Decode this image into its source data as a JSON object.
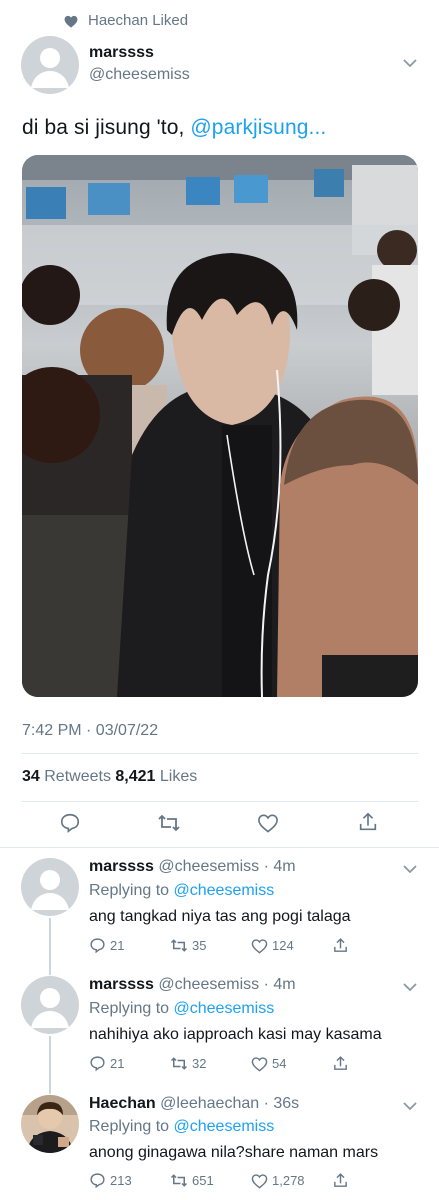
{
  "social_context": "Haechan Liked",
  "main_tweet": {
    "name": "marssss",
    "handle": "@cheesemiss",
    "text_prefix": "di ba si jisung 'to, ",
    "text_mention": "@parkjisung...",
    "timestamp": "7:42 PM · 03/07/22",
    "retweets_count": "34",
    "retweets_label": " Retweets  ",
    "likes_count": "8,421",
    "likes_label": " Likes"
  },
  "replies": [
    {
      "name": "marssss",
      "handle_time": " @cheesemiss · 4m",
      "replying_prefix": "Replying to ",
      "replying_to": "@cheesemiss",
      "text": "ang tangkad niya tas ang pogi talaga",
      "reply_count": "21",
      "retweet_count": "35",
      "like_count": "124"
    },
    {
      "name": "marssss",
      "handle_time": " @cheesemiss · 4m",
      "replying_prefix": "Replying to ",
      "replying_to": "@cheesemiss",
      "text": "nahihiya ako iapproach kasi may kasama",
      "reply_count": "21",
      "retweet_count": "32",
      "like_count": "54"
    },
    {
      "name": "Haechan",
      "handle_time": " @leehaechan · 36s",
      "replying_prefix": "Replying to ",
      "replying_to": "@cheesemiss",
      "text": "anong ginagawa nila?share naman mars",
      "reply_count": "213",
      "retweet_count": "651",
      "like_count": "1,278"
    }
  ],
  "colors": {
    "accent": "#1da1f2",
    "secondary_text": "#657786",
    "primary_text": "#14171a"
  }
}
